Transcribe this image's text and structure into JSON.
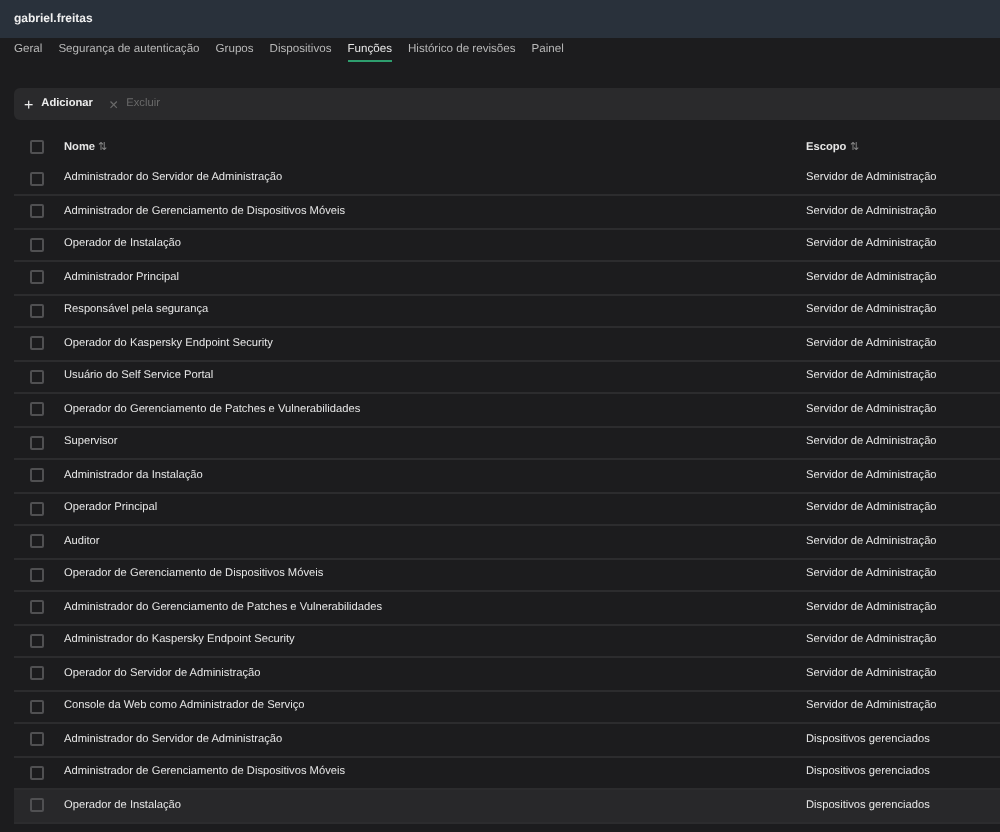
{
  "header": {
    "title": "gabriel.freitas"
  },
  "tabs": [
    {
      "label": "Geral",
      "selected": false
    },
    {
      "label": "Segurança de autenticação",
      "selected": false
    },
    {
      "label": "Grupos",
      "selected": false
    },
    {
      "label": "Dispositivos",
      "selected": false
    },
    {
      "label": "Funções",
      "selected": true
    },
    {
      "label": "Histórico de revisões",
      "selected": false
    },
    {
      "label": "Painel",
      "selected": false
    }
  ],
  "toolbar": [
    {
      "icon": "+",
      "label": "Adicionar",
      "disabled": false
    },
    {
      "icon": "×",
      "label": "Excluir",
      "disabled": true
    }
  ],
  "table": {
    "columns": [
      {
        "label": "Nome",
        "sort_icon": "⇅"
      },
      {
        "label": "Escopo",
        "sort_icon": "⇅"
      }
    ],
    "header_checked": false,
    "rows": [
      {
        "name": "Administrador do Servidor de Administração",
        "scope": "Servidor de Administração",
        "checked": false,
        "hovered": false
      },
      {
        "name": "Administrador de Gerenciamento de Dispositivos Móveis",
        "scope": "Servidor de Administração",
        "checked": false,
        "hovered": false
      },
      {
        "name": "Operador de Instalação",
        "scope": "Servidor de Administração",
        "checked": false,
        "hovered": false
      },
      {
        "name": "Administrador Principal",
        "scope": "Servidor de Administração",
        "checked": false,
        "hovered": false
      },
      {
        "name": "Responsável pela segurança",
        "scope": "Servidor de Administração",
        "checked": false,
        "hovered": false
      },
      {
        "name": "Operador do Kaspersky Endpoint Security",
        "scope": "Servidor de Administração",
        "checked": false,
        "hovered": false
      },
      {
        "name": "Usuário do Self Service Portal",
        "scope": "Servidor de Administração",
        "checked": false,
        "hovered": false
      },
      {
        "name": "Operador do Gerenciamento de Patches e Vulnerabilidades",
        "scope": "Servidor de Administração",
        "checked": false,
        "hovered": false
      },
      {
        "name": "Supervisor",
        "scope": "Servidor de Administração",
        "checked": false,
        "hovered": false
      },
      {
        "name": "Administrador da Instalação",
        "scope": "Servidor de Administração",
        "checked": false,
        "hovered": false
      },
      {
        "name": "Operador Principal",
        "scope": "Servidor de Administração",
        "checked": false,
        "hovered": false
      },
      {
        "name": "Auditor",
        "scope": "Servidor de Administração",
        "checked": false,
        "hovered": false
      },
      {
        "name": "Operador de Gerenciamento de Dispositivos Móveis",
        "scope": "Servidor de Administração",
        "checked": false,
        "hovered": false
      },
      {
        "name": "Administrador do Gerenciamento de Patches e Vulnerabilidades",
        "scope": "Servidor de Administração",
        "checked": false,
        "hovered": false
      },
      {
        "name": "Administrador do Kaspersky Endpoint Security",
        "scope": "Servidor de Administração",
        "checked": false,
        "hovered": false
      },
      {
        "name": "Operador do Servidor de Administração",
        "scope": "Servidor de Administração",
        "checked": false,
        "hovered": false
      },
      {
        "name": "Console da Web como Administrador de Serviço",
        "scope": "Servidor de Administração",
        "checked": false,
        "hovered": false
      },
      {
        "name": "Administrador do Servidor de Administração",
        "scope": "Dispositivos gerenciados",
        "checked": false,
        "hovered": false
      },
      {
        "name": "Administrador de Gerenciamento de Dispositivos Móveis",
        "scope": "Dispositivos gerenciados",
        "checked": false,
        "hovered": false
      },
      {
        "name": "Operador de Instalação",
        "scope": "Dispositivos gerenciados",
        "checked": false,
        "hovered": true
      }
    ]
  }
}
